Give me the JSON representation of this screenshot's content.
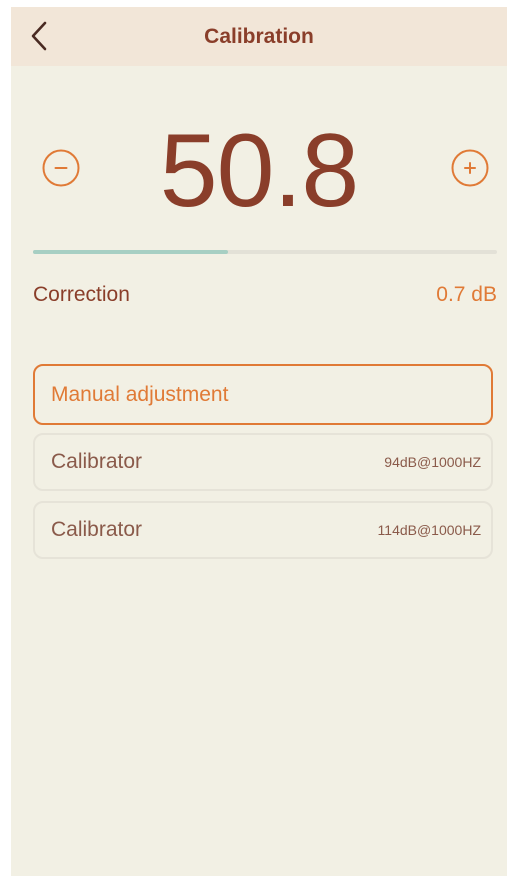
{
  "header": {
    "title": "Calibration",
    "back_icon": "chevron-left-icon"
  },
  "meter": {
    "value": "50.8",
    "decrement_icon": "minus-circle-icon",
    "increment_icon": "plus-circle-icon",
    "progress_fraction": 0.42
  },
  "correction": {
    "label": "Correction",
    "value": "0.7 dB"
  },
  "options": [
    {
      "label": "Manual adjustment",
      "value": "",
      "selected": true
    },
    {
      "label": "Calibrator",
      "value": "94dB@1000HZ",
      "selected": false
    },
    {
      "label": "Calibrator",
      "value": "114dB@1000HZ",
      "selected": false
    }
  ],
  "colors": {
    "background": "#f2f0e4",
    "header_background": "#f2e6d8",
    "primary_text": "#8a3e2a",
    "accent": "#e07a36",
    "progress": "#a7cfc3"
  }
}
